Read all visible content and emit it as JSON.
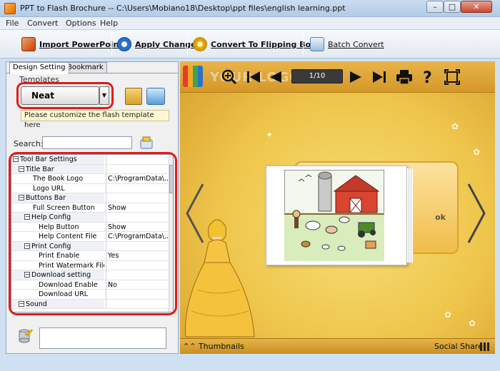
{
  "window": {
    "title": "PPT to Flash Brochure -- C:\\Users\\Mobiano18\\Desktop\\ppt files\\english learning.ppt",
    "minimize": "–",
    "maximize": "□",
    "close": "✕"
  },
  "menu": [
    "File",
    "Convert",
    "Options",
    "Help"
  ],
  "toolbar": {
    "import_label": "Import PowerPoint",
    "apply_label": "Apply Change",
    "convert_label": "Convert To Flipping Book",
    "batch_label": "Batch Convert"
  },
  "left": {
    "tabs": [
      "Design Setting",
      "Bookmark"
    ],
    "templates_label": "Templates",
    "template_name": "Neat",
    "template_hint": "Please customize the flash template here",
    "search_label": "Search:",
    "search_value": ""
  },
  "properties": [
    {
      "name": "Tool Bar Settings",
      "value": "",
      "level": 0,
      "toggle": "−"
    },
    {
      "name": "Title Bar",
      "value": "",
      "level": 1,
      "toggle": "−"
    },
    {
      "name": "The Book Logo",
      "value": "C:\\ProgramData\\...",
      "level": 2,
      "toggle": ""
    },
    {
      "name": "Logo URL",
      "value": "",
      "level": 2,
      "toggle": ""
    },
    {
      "name": "Buttons Bar",
      "value": "",
      "level": 1,
      "toggle": "−"
    },
    {
      "name": "Full Screen Button",
      "value": "Show",
      "level": 2,
      "toggle": ""
    },
    {
      "name": "Help Config",
      "value": "",
      "level": 2,
      "toggle": "−"
    },
    {
      "name": "Help Button",
      "value": "Show",
      "level": 3,
      "toggle": ""
    },
    {
      "name": "Help Content File",
      "value": "C:\\ProgramData\\...",
      "level": 3,
      "toggle": ""
    },
    {
      "name": "Print Config",
      "value": "",
      "level": 2,
      "toggle": "−"
    },
    {
      "name": "Print Enable",
      "value": "Yes",
      "level": 3,
      "toggle": ""
    },
    {
      "name": "Print Watermark File",
      "value": "",
      "level": 3,
      "toggle": ""
    },
    {
      "name": "Download setting",
      "value": "",
      "level": 2,
      "toggle": "−"
    },
    {
      "name": "Download Enable",
      "value": "No",
      "level": 3,
      "toggle": ""
    },
    {
      "name": "Download URL",
      "value": "",
      "level": 3,
      "toggle": ""
    },
    {
      "name": "Sound",
      "value": "",
      "level": 1,
      "toggle": "−"
    }
  ],
  "preview": {
    "logo_text": "YOUR LOGO",
    "page_indicator": "1/10",
    "page_label_fragment": "ok",
    "thumbnails_label": "Thumbnails",
    "social_share_label": "Social Share",
    "colors": {
      "toolbar": "#d49828",
      "background": "#eec54a",
      "highlight_ring": "#e21b1b"
    }
  }
}
